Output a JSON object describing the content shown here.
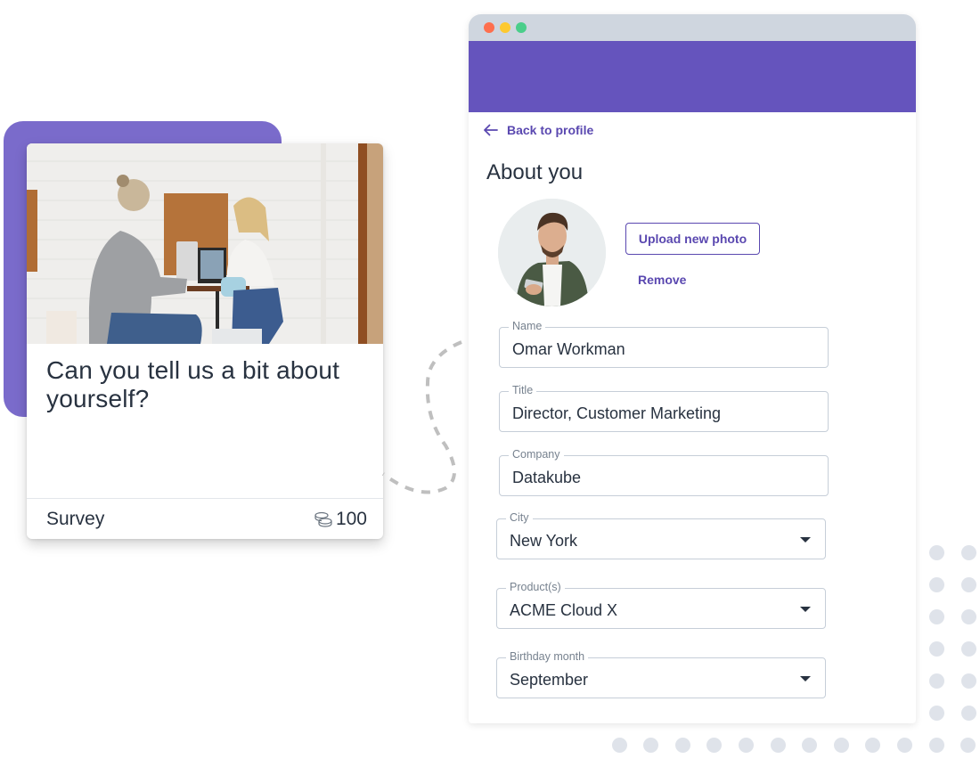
{
  "survey_card": {
    "question": "Can you tell us a bit about yourself?",
    "type_label": "Survey",
    "points": "100",
    "points_icon": "coins-icon",
    "photo_alt": "Two people laughing at a table with laptops"
  },
  "window": {
    "controls": [
      "close",
      "minimize",
      "maximize"
    ],
    "back_link": "Back to profile",
    "title": "About you",
    "avatar_alt": "Profile photo of man with phone",
    "upload_button": "Upload new photo",
    "remove_link": "Remove",
    "fields": {
      "name": {
        "label": "Name",
        "value": "Omar Workman"
      },
      "title": {
        "label": "Title",
        "value": "Director, Customer Marketing"
      },
      "company": {
        "label": "Company",
        "value": "Datakube"
      },
      "city": {
        "label": "City",
        "value": "New York"
      },
      "products": {
        "label": "Product(s)",
        "value": "ACME Cloud X"
      },
      "birthday_month": {
        "label": "Birthday month",
        "value": "September"
      }
    }
  },
  "colors": {
    "brand_purple": "#6554bd",
    "backdrop_purple": "#7a6bcb",
    "link_purple": "#5a48b0",
    "titlebar_gray": "#cfd6df",
    "text_dark": "#283240",
    "dot_red": "#fe6f4e",
    "dot_yellow": "#fdc92f",
    "dot_green": "#4ace8a"
  }
}
